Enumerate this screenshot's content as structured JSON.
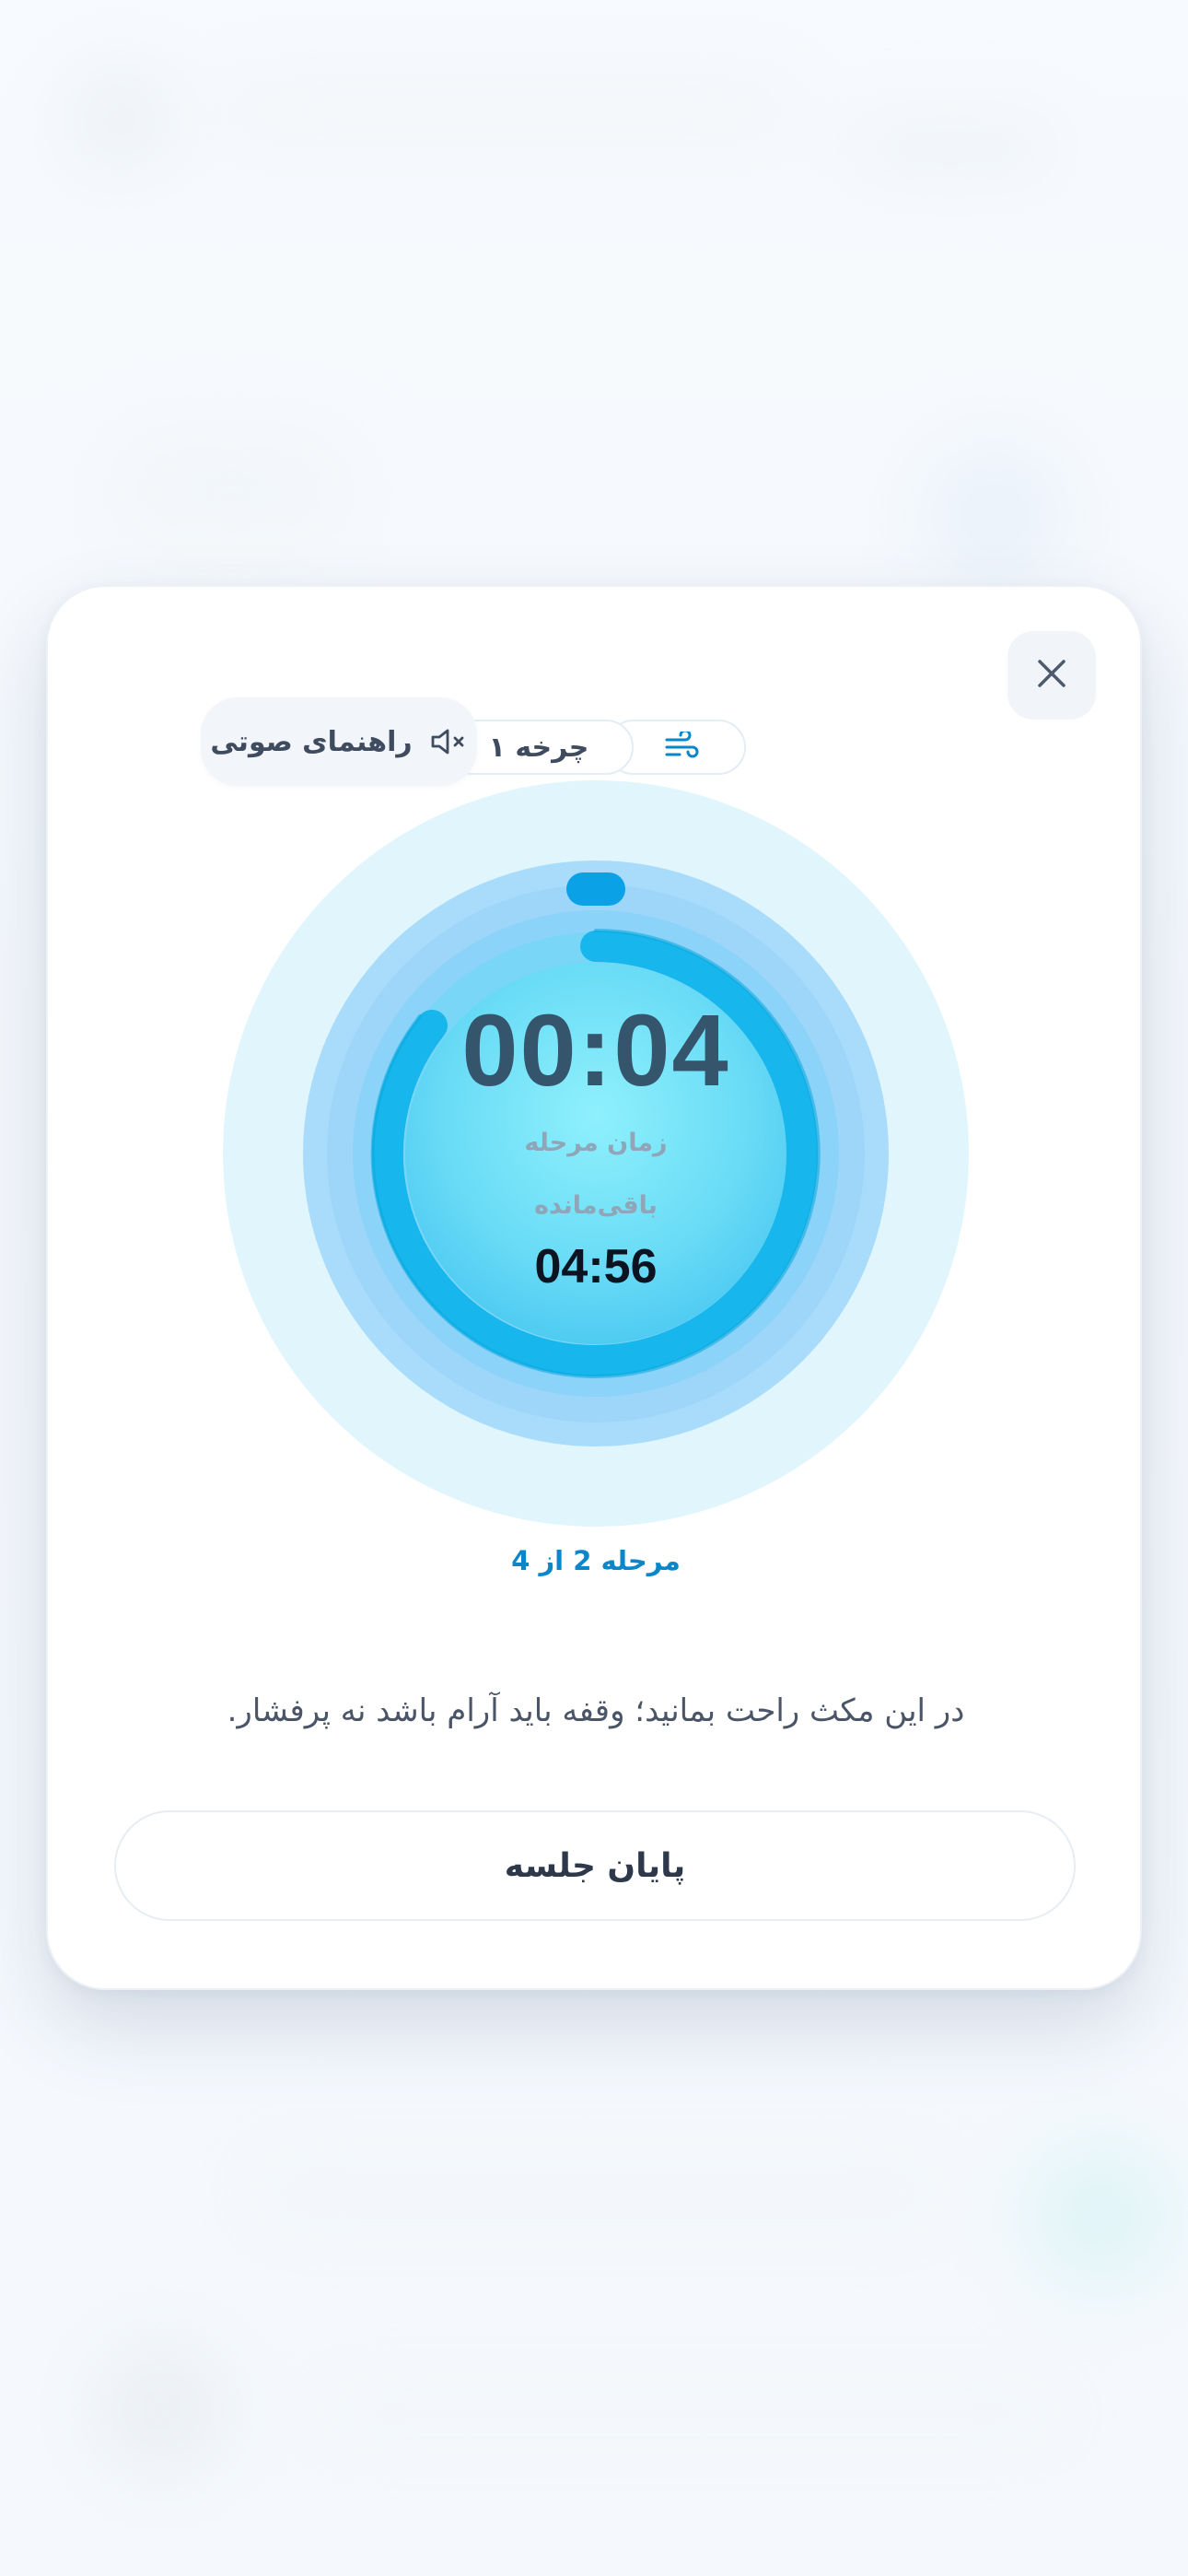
{
  "modal": {
    "cycle_label": "چرخه ۱",
    "voice_guide_label": "راهنمای صوتی",
    "phase_time": "00:04",
    "phase_time_label": "زمان مرحله",
    "remaining_label": "باقی‌مانده",
    "remaining_time": "04:56",
    "step_label": "مرحله 2 از 4",
    "instruction": "در این مکث راحت بمانید؛ وقفه باید آرام باشد نه پرفشار.",
    "end_session_label": "پایان جلسه"
  },
  "icons": {
    "close": "close-icon",
    "wind": "wind-icon",
    "mute": "speaker-mute-icon"
  },
  "colors": {
    "accent": "#0a86c9",
    "dial_outer": "#dff5fc",
    "dial_ring": "#a9dcfb",
    "dial_inner": "#6fdcf6",
    "progress": "#17b6ec"
  }
}
